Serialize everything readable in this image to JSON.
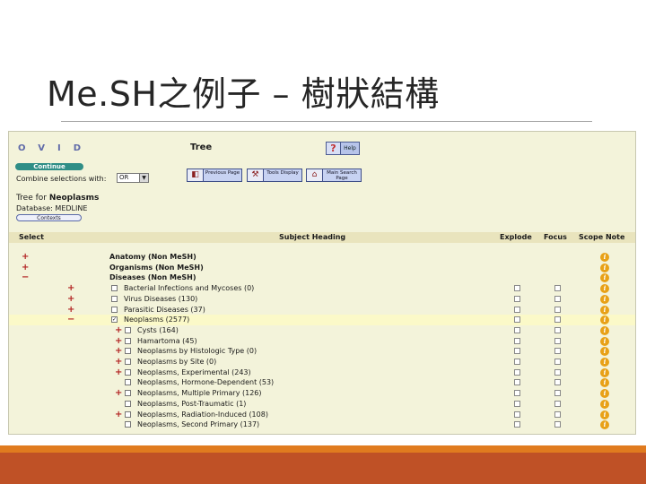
{
  "slide": {
    "title": "Me.SH之例子 – 樹狀結構"
  },
  "ovid": {
    "logo": "OVID",
    "tree_label": "Tree",
    "help": {
      "icon": "?",
      "label": "Help"
    }
  },
  "controls": {
    "continue_label": "Continue",
    "combine_label": "Combine selections with:",
    "combine_value": "OR",
    "prev_label": "Previous Page",
    "tools_label": "Tools Display",
    "main_label": "Main Search Page",
    "tree_for_prefix": "Tree for ",
    "tree_for_term": "Neoplasms",
    "database": "Database: MEDLINE",
    "contexts_label": "Contexts"
  },
  "table": {
    "headers": {
      "select": "Select",
      "subject": "Subject Heading",
      "explode": "Explode",
      "focus": "Focus",
      "scope": "Scope Note"
    },
    "rows": [
      {
        "sign": "+",
        "label": "Anatomy (Non MeSH)",
        "level": 0,
        "checkbox": false,
        "bold": true
      },
      {
        "sign": "+",
        "label": "Organisms (Non MeSH)",
        "level": 0,
        "checkbox": false,
        "bold": true
      },
      {
        "sign": "−",
        "label": "Diseases (Non MeSH)",
        "level": 0,
        "checkbox": false,
        "bold": true
      },
      {
        "sign": "+",
        "label": "Bacterial Infections and Mycoses (0)",
        "level": 1,
        "checkbox": true,
        "checked": false
      },
      {
        "sign": "+",
        "label": "Virus Diseases (130)",
        "level": 1,
        "checkbox": true,
        "checked": false
      },
      {
        "sign": "+",
        "label": "Parasitic Diseases (37)",
        "level": 1,
        "checkbox": true,
        "checked": false
      },
      {
        "sign": "−",
        "label": "Neoplasms (2577)",
        "level": 1,
        "checkbox": true,
        "checked": true,
        "highlight": true
      },
      {
        "sign": "+",
        "label": "Cysts (164)",
        "level": 2,
        "checkbox": true,
        "checked": false
      },
      {
        "sign": "+",
        "label": "Hamartoma (45)",
        "level": 2,
        "checkbox": true,
        "checked": false
      },
      {
        "sign": "+",
        "label": "Neoplasms by Histologic Type (0)",
        "level": 2,
        "checkbox": true,
        "checked": false
      },
      {
        "sign": "+",
        "label": "Neoplasms by Site (0)",
        "level": 2,
        "checkbox": true,
        "checked": false
      },
      {
        "sign": "+",
        "label": "Neoplasms, Experimental (243)",
        "level": 2,
        "checkbox": true,
        "checked": false
      },
      {
        "sign": "",
        "label": "Neoplasms, Hormone-Dependent (53)",
        "level": 2,
        "checkbox": true,
        "checked": false
      },
      {
        "sign": "+",
        "label": "Neoplasms, Multiple Primary (126)",
        "level": 2,
        "checkbox": true,
        "checked": false
      },
      {
        "sign": "",
        "label": "Neoplasms, Post-Traumatic (1)",
        "level": 2,
        "checkbox": true,
        "checked": false
      },
      {
        "sign": "+",
        "label": "Neoplasms, Radiation-Induced (108)",
        "level": 2,
        "checkbox": true,
        "checked": false
      },
      {
        "sign": "",
        "label": "Neoplasms, Second Primary (137)",
        "level": 2,
        "checkbox": true,
        "checked": false
      }
    ],
    "scope_icon": "i",
    "check_mark": "✓"
  },
  "colors": {
    "footer_orange": "#e07b1f",
    "footer_rust": "#bf5126",
    "panel_bg": "#f3f3da"
  }
}
